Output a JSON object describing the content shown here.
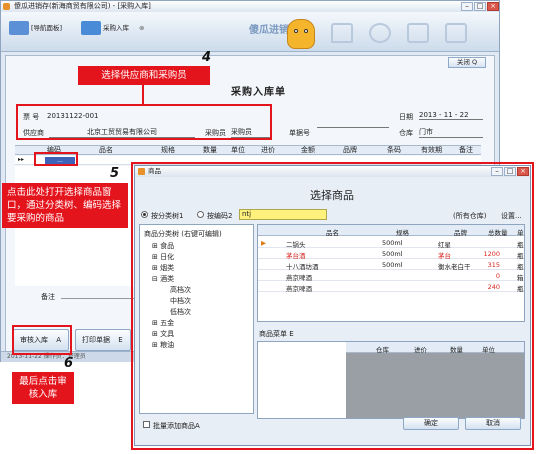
{
  "window": {
    "title": "傻瓜进销存(新海商贸有限公司) - [采购入库]",
    "controls": [
      "–",
      "□",
      "×"
    ]
  },
  "toolbar": {
    "tabs": [
      {
        "label": "[导航面板]"
      },
      {
        "label": "采购入库"
      }
    ],
    "tab_close": "⊗",
    "logo_text": "傻瓜进销存"
  },
  "form": {
    "close_label": "关闭 Q",
    "title": "采购入库单",
    "ticket_label": "票  号",
    "ticket_value": "20131122-001",
    "date_label": "日期",
    "date_value": "2013 - 11 - 22",
    "supplier_label": "供应商",
    "supplier_value": "北京工贸贸易有限公司",
    "buyer_label": "采购员",
    "buyer_value": "采购员",
    "order_label": "单据号",
    "order_value": "",
    "warehouse_label": "仓库",
    "warehouse_value": "门市",
    "columns": [
      "编码",
      "品名",
      "规格",
      "数量",
      "单位",
      "进价",
      "金额",
      "品牌",
      "条码",
      "有效期",
      "备注"
    ],
    "row_marker": "▸▸",
    "selected_cell": "...",
    "note_label": "备注"
  },
  "buttons": {
    "audit": "审核入库",
    "audit_key": "A",
    "print": "打印单据",
    "print_key": "E"
  },
  "statusbar": {
    "text": "2013-11-22   操作员：管理员"
  },
  "callouts": {
    "step4_num": "4",
    "step4_text": "选择供应商和采购员",
    "step5_num": "5",
    "step5_text": "点击此处打开选择商品窗口，通过分类树、编码选择要采购的商品",
    "step6_num": "6",
    "step6_text": "最后点击审核入库"
  },
  "dialog": {
    "title": "商品",
    "heading": "选择商品",
    "radio_category": "按分类树",
    "radio_category_key": "1",
    "radio_code": "按编码",
    "radio_code_key": "2",
    "search_value": "ntj",
    "all_warehouses": "(所有仓库)",
    "settings": "设置...",
    "tree": {
      "root": "商品分类树 (右键可编辑)",
      "items": [
        "食品",
        "日化",
        "烟类",
        "酒类",
        "高档次",
        "中档次",
        "低档次",
        "五金",
        "文具",
        "粮油"
      ]
    },
    "grid_columns": [
      "品名",
      "规格",
      "品牌",
      "总数量",
      "单"
    ],
    "products": [
      {
        "name": "二锅头",
        "spec": "500ml",
        "brand": "红星",
        "qty": "",
        "unit": "瓶",
        "color": "#222222"
      },
      {
        "name": "茅台酒",
        "spec": "500ml",
        "brand": "茅台",
        "qty": "1200",
        "unit": "瓶",
        "color": "#d8241d"
      },
      {
        "name": "十八酒坊酒",
        "spec": "500ml",
        "brand": "衡水老白干",
        "qty": "315",
        "unit": "瓶",
        "color": "#222222"
      },
      {
        "name": "燕京啤酒",
        "spec": "",
        "brand": "",
        "qty": "0",
        "unit": "箱",
        "color": "#222222"
      },
      {
        "name": "燕京啤酒",
        "spec": "",
        "brand": "",
        "qty": "240",
        "unit": "瓶",
        "color": "#222222"
      }
    ],
    "cart_label": "商品菜单",
    "cart_key": "E",
    "cart_columns": [
      "仓库",
      "进价",
      "数量",
      "单位"
    ],
    "batch_label": "批量添加商品",
    "batch_key": "A",
    "ok": "确定",
    "cancel": "取消"
  }
}
